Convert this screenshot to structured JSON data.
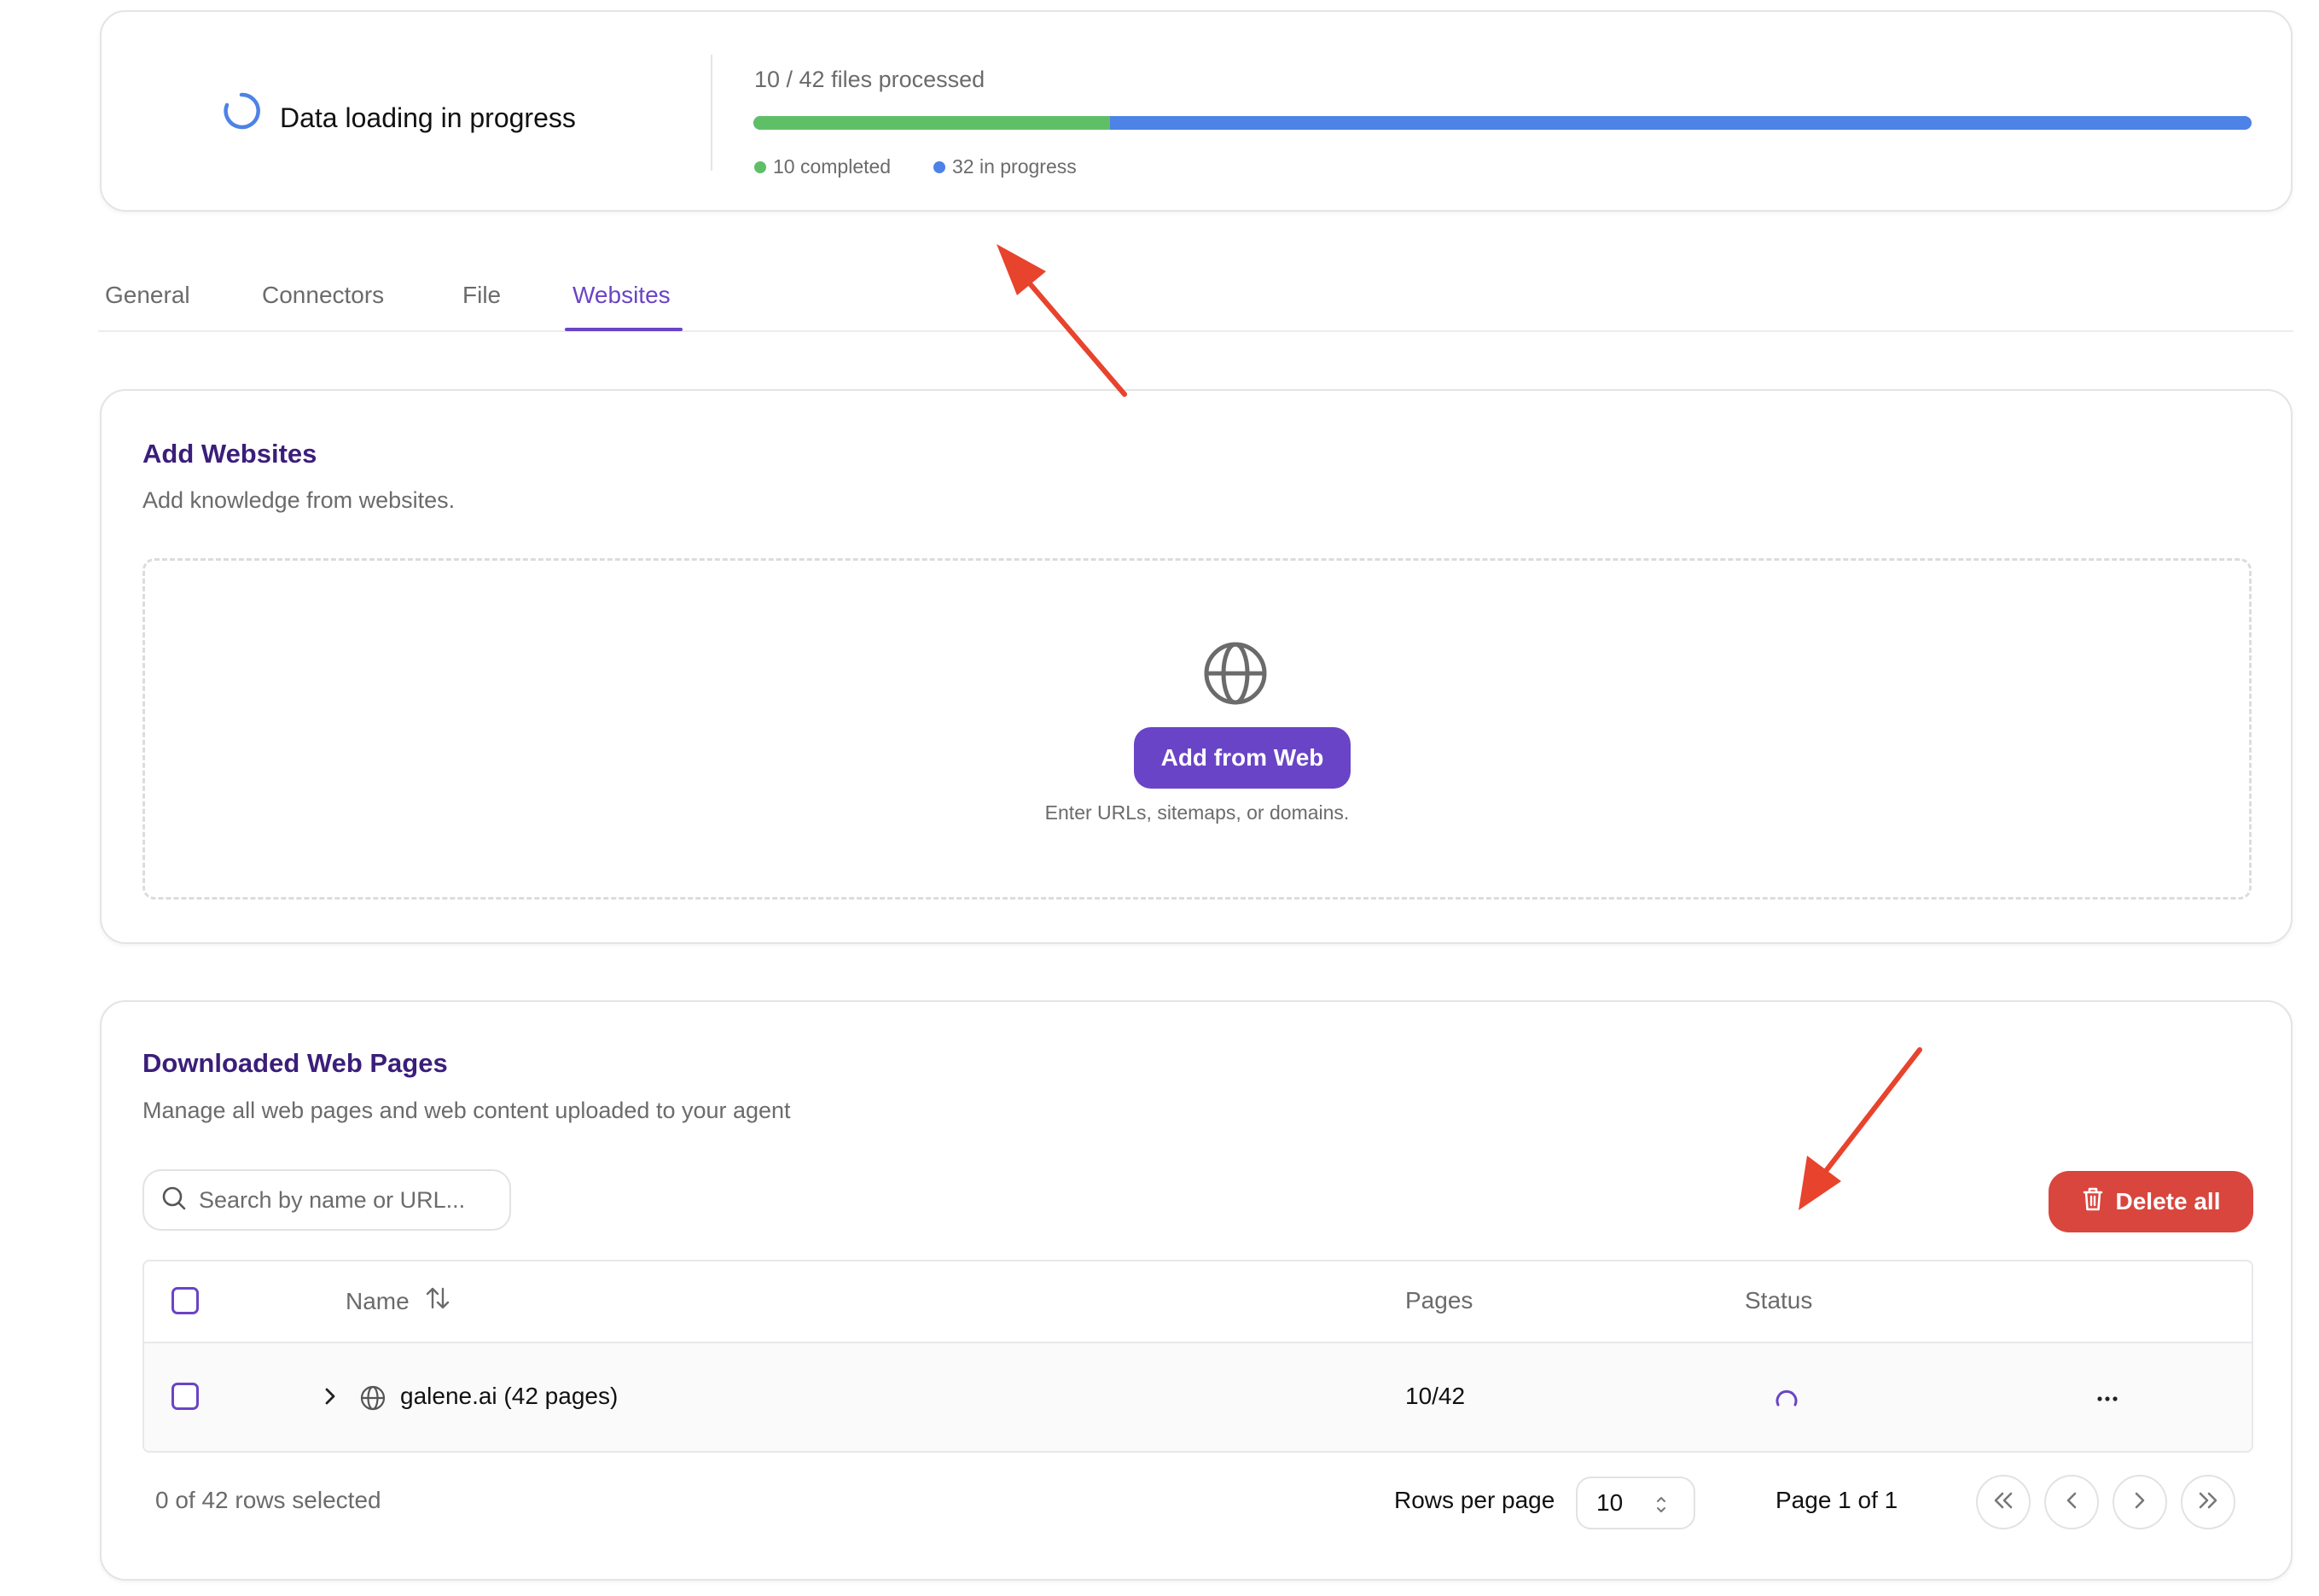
{
  "progress": {
    "title": "Data loading in progress",
    "processed_text": "10 / 42 files processed",
    "completed_fraction": 0.238,
    "completed_label": "10 completed",
    "in_progress_label": "32 in progress",
    "colors": {
      "completed": "#5fbf67",
      "in_progress": "#4d82e6"
    }
  },
  "tabs": [
    {
      "label": "General"
    },
    {
      "label": "Connectors"
    },
    {
      "label": "File"
    },
    {
      "label": "Websites",
      "active": true
    }
  ],
  "add_websites": {
    "title": "Add Websites",
    "subtitle": "Add knowledge from websites.",
    "button_label": "Add from Web",
    "hint": "Enter URLs, sitemaps, or domains."
  },
  "downloaded": {
    "title": "Downloaded Web Pages",
    "subtitle": "Manage all web pages and web content uploaded to your agent",
    "search_placeholder": "Search by name or URL...",
    "delete_all_label": "Delete all",
    "columns": {
      "name": "Name",
      "pages": "Pages",
      "status": "Status"
    },
    "rows": [
      {
        "name": "galene.ai (42 pages)",
        "pages": "10/42",
        "status": "loading"
      }
    ],
    "selection_text": "0 of 42 rows selected",
    "rows_per_page_label": "Rows per page",
    "rows_per_page_value": "10",
    "page_text": "Page 1 of 1"
  },
  "theme": {
    "accent": "#6a44c6",
    "danger": "#d9463e",
    "annotation": "#e8432d"
  }
}
